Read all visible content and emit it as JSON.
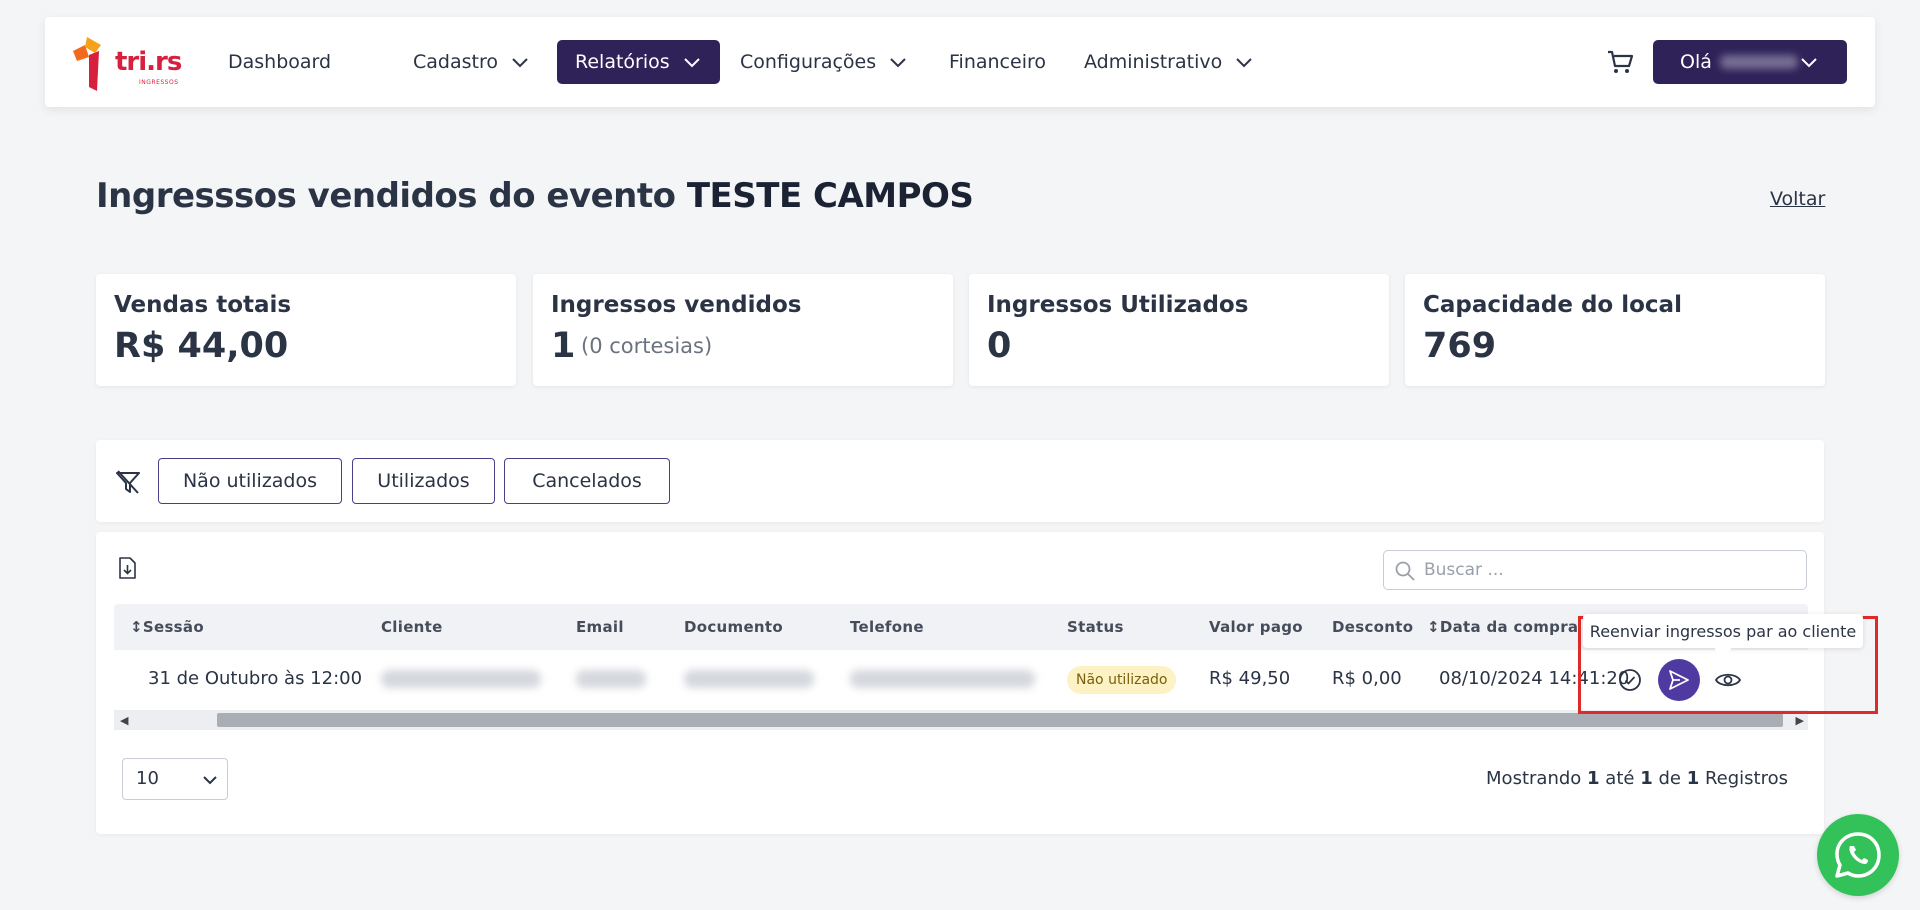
{
  "brand": {
    "logo_text": "tri.rs",
    "logo_sub": "INGRESSOS",
    "color": "#d6203d"
  },
  "nav": {
    "items": [
      {
        "label": "Dashboard"
      },
      {
        "label": "Cadastro"
      },
      {
        "label": "Relatórios"
      },
      {
        "label": "Configurações"
      },
      {
        "label": "Financeiro"
      },
      {
        "label": "Administrativo"
      }
    ],
    "active_color": "#2e2259",
    "user_greeting": "Olá"
  },
  "page": {
    "title": "Ingresssos vendidos do evento",
    "event": "TESTE CAMPOS",
    "back_label": "Voltar"
  },
  "stats": [
    {
      "label": "Vendas totais",
      "value": "R$ 44,00"
    },
    {
      "label": "Ingressos vendidos",
      "value": "1",
      "extra": "(0 cortesias)"
    },
    {
      "label": "Ingressos Utilizados",
      "value": "0"
    },
    {
      "label": "Capacidade do local",
      "value": "769"
    }
  ],
  "filters": [
    "Não utilizados",
    "Utilizados",
    "Cancelados"
  ],
  "table": {
    "search_placeholder": "Buscar ...",
    "columns": [
      "Sessão",
      "Cliente",
      "Email",
      "Documento",
      "Telefone",
      "Status",
      "Valor pago",
      "Desconto",
      "Data da compra"
    ],
    "rows": [
      {
        "sessao": "31 de Outubro às 12:00",
        "status": "Não utilizado",
        "valor_pago": "R$ 49,50",
        "desconto": "R$ 0,00",
        "data_compra": "08/10/2024 14:41:20"
      }
    ],
    "tooltip": "Reenviar ingressos par ao cliente",
    "page_size": "10",
    "records": {
      "prefix": "Mostrando",
      "from": "1",
      "to_word": "até",
      "to": "1",
      "of_word": "de",
      "total": "1",
      "suffix": "Registros"
    }
  }
}
